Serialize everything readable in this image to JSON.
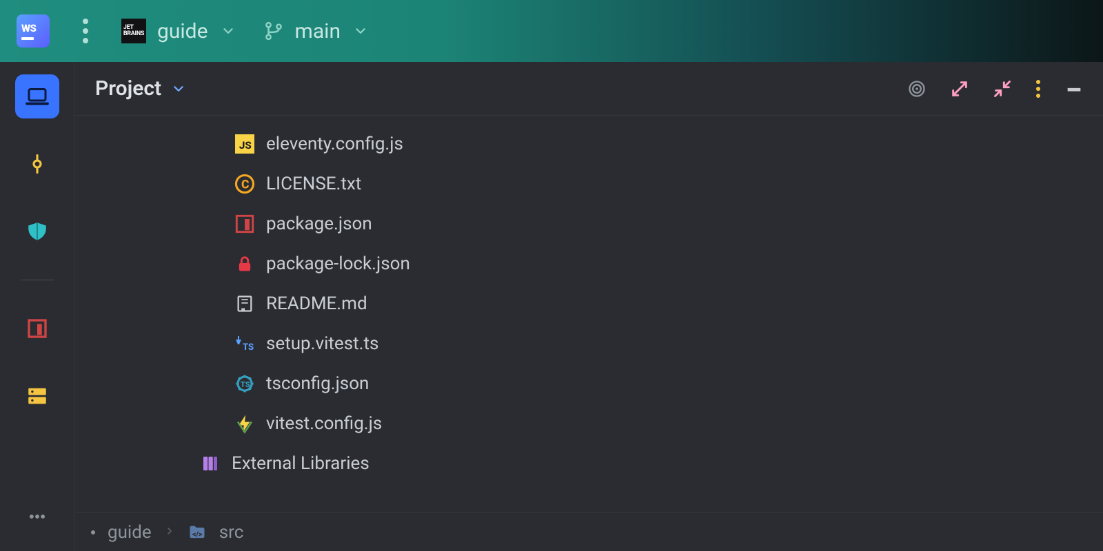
{
  "titlebar": {
    "logo_label": "WS",
    "project_name": "guide",
    "branch_name": "main"
  },
  "pane": {
    "title": "Project"
  },
  "tree": {
    "items": [
      {
        "id": "eleventy-config",
        "label": "eleventy.config.js",
        "icon": "js-icon"
      },
      {
        "id": "license",
        "label": "LICENSE.txt",
        "icon": "copyright-icon"
      },
      {
        "id": "package-json",
        "label": "package.json",
        "icon": "npm-icon"
      },
      {
        "id": "package-lock",
        "label": "package-lock.json",
        "icon": "lock-icon"
      },
      {
        "id": "readme",
        "label": "README.md",
        "icon": "book-icon"
      },
      {
        "id": "setup-vitest",
        "label": "setup.vitest.ts",
        "icon": "vitest-ts-icon"
      },
      {
        "id": "tsconfig",
        "label": "tsconfig.json",
        "icon": "ts-gear-icon"
      },
      {
        "id": "vitest-config",
        "label": "vitest.config.js",
        "icon": "vitest-icon"
      }
    ],
    "external_libraries_label": "External Libraries"
  },
  "breadcrumb": {
    "root": "guide",
    "current": "src"
  },
  "colors": {
    "accent_blue": "#3874ff",
    "js_yellow": "#f8d247",
    "copyright_orange": "#f5a623",
    "npm_red": "#d14446",
    "lock_red": "#e63946",
    "vitest_blue": "#5aa0ff",
    "vitest_yellow": "#f8d247",
    "ts_teal": "#35a0bf",
    "lib_purple": "#b77fe8"
  }
}
